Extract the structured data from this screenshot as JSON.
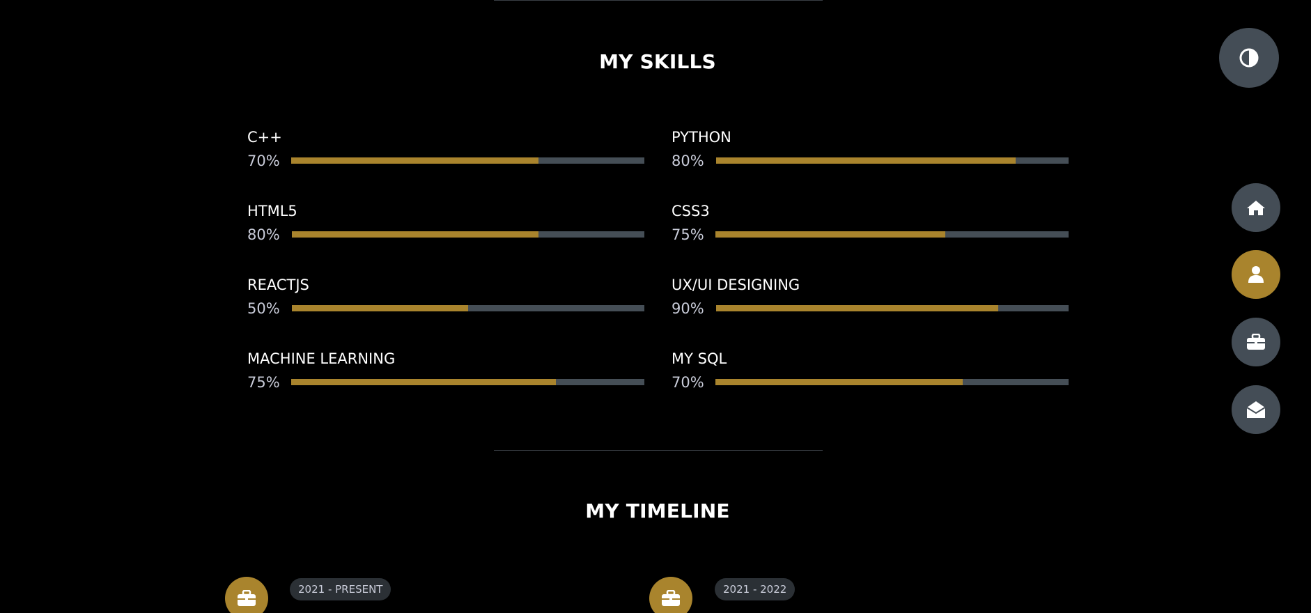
{
  "skills_section": {
    "title": "MY SKILLS",
    "items": [
      {
        "name": "C++",
        "percent_label": "70%",
        "bar_fill": 0.7
      },
      {
        "name": "PYTHON",
        "percent_label": "80%",
        "bar_fill": 0.85
      },
      {
        "name": "HTML5",
        "percent_label": "80%",
        "bar_fill": 0.7
      },
      {
        "name": "CSS3",
        "percent_label": "75%",
        "bar_fill": 0.65
      },
      {
        "name": "REACTJS",
        "percent_label": "50%",
        "bar_fill": 0.5
      },
      {
        "name": "UX/UI DESIGNING",
        "percent_label": "90%",
        "bar_fill": 0.8
      },
      {
        "name": "MACHINE LEARNING",
        "percent_label": "75%",
        "bar_fill": 0.75
      },
      {
        "name": "MY SQL",
        "percent_label": "70%",
        "bar_fill": 0.7
      }
    ]
  },
  "timeline_section": {
    "title": "MY TIMELINE",
    "entries": [
      {
        "date": "2021 - PRESENT",
        "icon": "briefcase-icon"
      },
      {
        "date": "2021 - 2022",
        "icon": "briefcase-icon"
      }
    ]
  },
  "floating_controls": {
    "theme_toggle": {
      "icon": "contrast-icon"
    },
    "nav": [
      {
        "name": "home",
        "icon": "home-icon",
        "active": false
      },
      {
        "name": "about",
        "icon": "user-icon",
        "active": true
      },
      {
        "name": "portfolio",
        "icon": "briefcase-icon",
        "active": false
      },
      {
        "name": "contact",
        "icon": "envelope-open-icon",
        "active": false
      }
    ]
  },
  "colors": {
    "background": "#000000",
    "accent": "#a9842d",
    "track": "#454e56",
    "button": "#444d56",
    "badge": "#2b3035",
    "muted_text": "#c9ccd9"
  }
}
